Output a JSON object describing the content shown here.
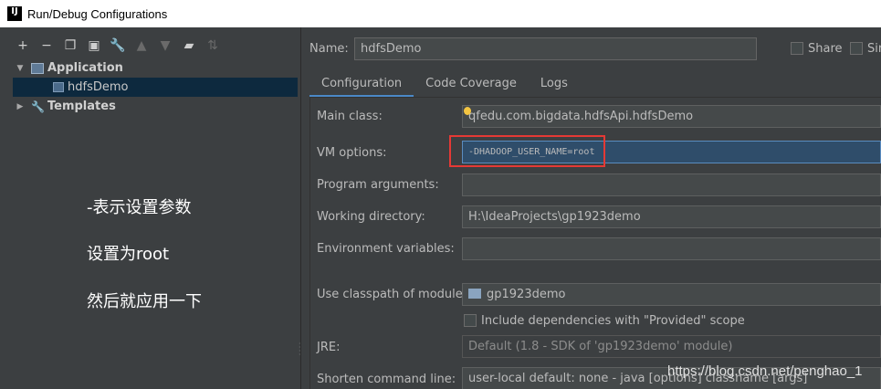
{
  "window": {
    "title": "Run/Debug Configurations",
    "app_icon_text": "IJ"
  },
  "toolbar": {
    "icons": [
      "add-icon",
      "remove-icon",
      "copy-icon",
      "save-icon",
      "wrench-icon",
      "move-up-icon",
      "move-down-icon",
      "folder-add-icon",
      "sort-icon"
    ]
  },
  "tree": {
    "application": "Application",
    "config": "hdfsDemo",
    "templates": "Templates"
  },
  "annotations": {
    "line1": "-表示设置参数",
    "line2": "设置为root",
    "line3": "然后就应用一下"
  },
  "form": {
    "name_label": "Name:",
    "name_value": "hdfsDemo",
    "share_label": "Share",
    "single_label": "Sir",
    "tabs": [
      "Configuration",
      "Code Coverage",
      "Logs"
    ],
    "main_class_label": "Main class:",
    "main_class_value": "qfedu.com.bigdata.hdfsApi.hdfsDemo",
    "vm_options_label": "VM options:",
    "vm_options_value": "-DHADOOP_USER_NAME=root",
    "program_args_label": "Program arguments:",
    "program_args_value": "",
    "working_dir_label": "Working directory:",
    "working_dir_value": "H:\\IdeaProjects\\gp1923demo",
    "env_vars_label": "Environment variables:",
    "env_vars_value": "",
    "classpath_label": "Use classpath of module:",
    "classpath_value": "gp1923demo",
    "include_deps_label": "Include dependencies with \"Provided\" scope",
    "jre_label": "JRE:",
    "jre_value": "Default (1.8 - SDK of 'gp1923demo' module)",
    "shorten_label": "Shorten command line:",
    "shorten_value": "user-local default: none - java [options] classname [args]"
  },
  "watermark": "https://blog.csdn.net/penghao_1",
  "colors": {
    "accent": "#4a88c7",
    "highlight_box": "#e53935",
    "selection": "#0d293e"
  }
}
